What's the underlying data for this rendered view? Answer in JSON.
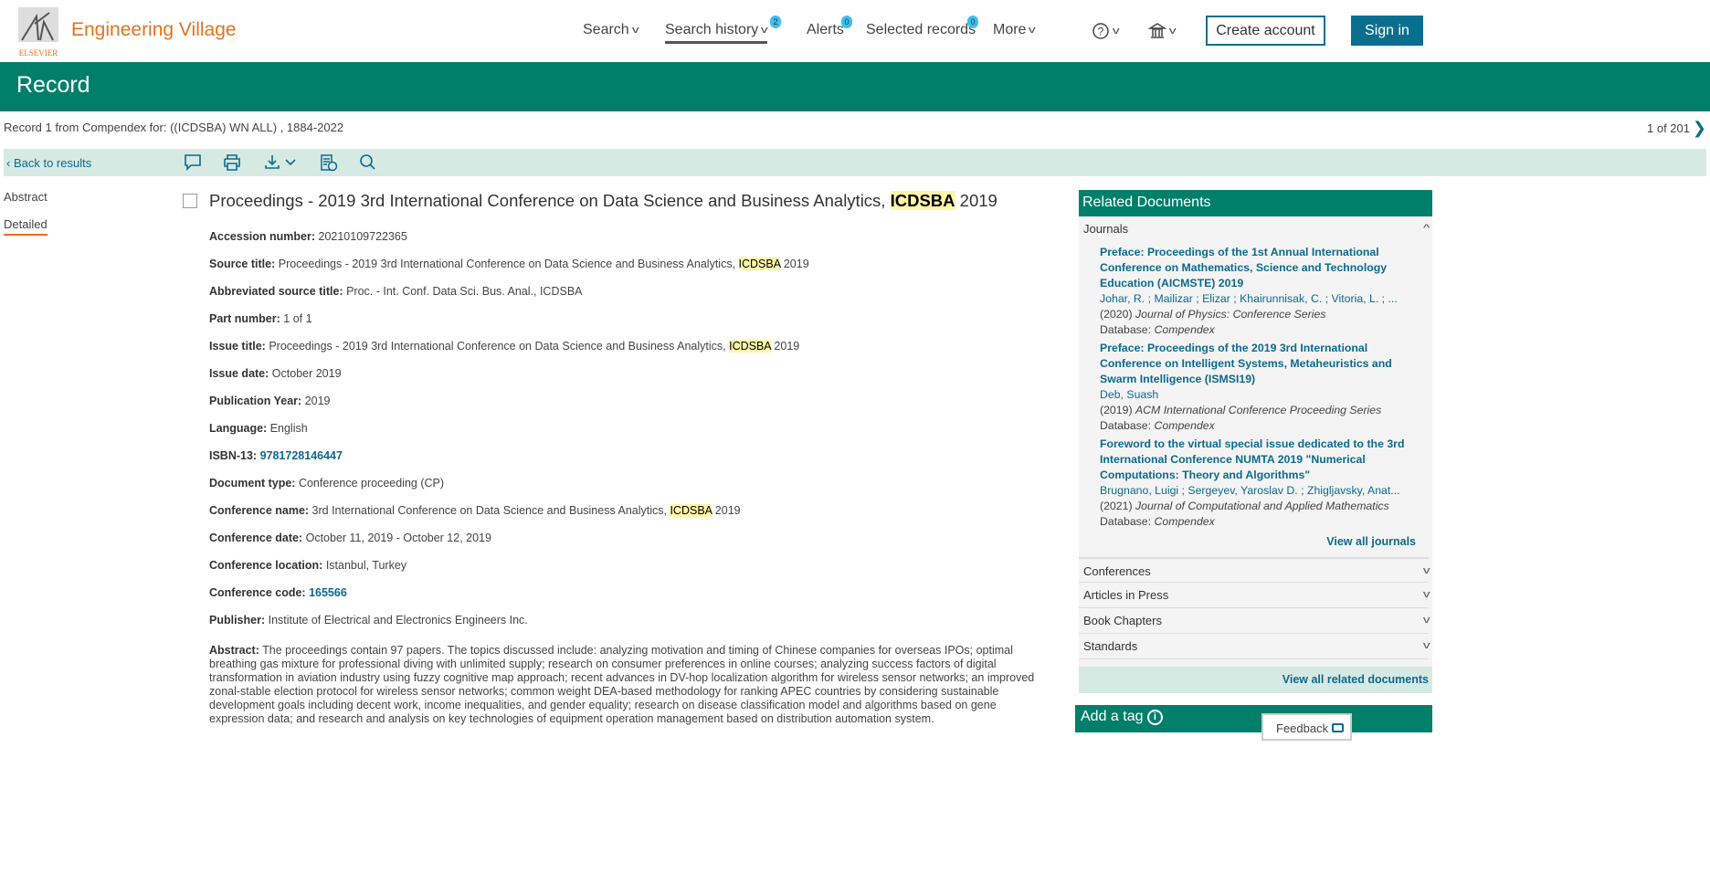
{
  "header": {
    "brand": "Engineering Village",
    "logo_text": "ELSEVIER",
    "nav": [
      {
        "label": "Search"
      },
      {
        "label": "Search history",
        "badge": "2"
      },
      {
        "label": "Alerts",
        "badge": "0"
      },
      {
        "label": "Selected records",
        "badge": "0"
      },
      {
        "label": "More"
      }
    ],
    "create_account": "Create account",
    "sign_in": "Sign in"
  },
  "banner": {
    "title": "Record"
  },
  "crumb": "Record 1 from Compendex for: ((ICDSBA) WN ALL) , 1884-2022",
  "pager": "1 of 201",
  "toolbar": {
    "back": "Back to results"
  },
  "side": {
    "abstract": "Abstract",
    "detailed": "Detailed"
  },
  "record": {
    "title_pre": "Proceedings - 2019 3rd International Conference on Data Science and Business Analytics, ",
    "title_hl": "ICDSBA",
    "title_post": " 2019",
    "fields": [
      {
        "label": "Accession number:",
        "value": "20210109722365"
      },
      {
        "label": "Source title:",
        "value": "Proceedings - 2019 3rd International Conference on Data Science and Business Analytics, ",
        "hl": "ICDSBA",
        "after": " 2019"
      },
      {
        "label": "Abbreviated source title:",
        "value": "Proc. - Int. Conf. Data Sci. Bus. Anal., ICDSBA"
      },
      {
        "label": "Part number:",
        "value": "1 of 1"
      },
      {
        "label": "Issue title:",
        "value": "Proceedings - 2019 3rd International Conference on Data Science and Business Analytics, ",
        "hl": "ICDSBA",
        "after": " 2019"
      },
      {
        "label": "Issue date:",
        "value": "October 2019"
      },
      {
        "label": "Publication Year:",
        "value": "2019"
      },
      {
        "label": "Language:",
        "value": "English"
      },
      {
        "label": "ISBN-13:",
        "link": "9781728146447"
      },
      {
        "label": "Document type:",
        "value": "Conference proceeding (CP)"
      },
      {
        "label": "Conference name:",
        "value": "3rd International Conference on Data Science and Business Analytics, ",
        "hl": "ICDSBA",
        "after": " 2019"
      },
      {
        "label": "Conference date:",
        "value": "October 11, 2019 - October 12, 2019"
      },
      {
        "label": "Conference location:",
        "value": "Istanbul, Turkey"
      },
      {
        "label": "Conference code:",
        "link": "165566"
      },
      {
        "label": "Publisher:",
        "value": "Institute of Electrical and Electronics Engineers Inc."
      }
    ],
    "abstract_label": "Abstract:",
    "abstract": "The proceedings contain 97 papers. The topics discussed include: analyzing motivation and timing of Chinese companies for overseas IPOs; optimal breathing gas mixture for professional diving with unlimited supply; research on consumer preferences in online courses; analyzing success factors of digital transformation in aviation industry using fuzzy cognitive map approach; recent advances in DV-hop localization algorithm for wireless sensor networks; an improved zonal-stable election protocol for wireless sensor networks; common weight DEA-based methodology for ranking APEC countries by considering sustainable development goals including decent work, income inequalities, and gender equality; research on disease classification model and algorithms based on gene expression data; and research and analysis on key technologies of equipment operation management based on distribution automation system."
  },
  "related": {
    "title": "Related Documents",
    "journals_label": "Journals",
    "items": [
      {
        "title": "Preface: Proceedings of the 1st Annual International Conference on Mathematics, Science and Technology Education (AICMSTE) 2019",
        "authors": "Johar, R. ; Mailizar ; Elizar ; Khairunnisak, C. ; Vitoria, L. ; ...",
        "year": "(2020) ",
        "journal": "Journal of Physics: Conference Series",
        "db_label": "Database: ",
        "db": "Compendex"
      },
      {
        "title": "Preface: Proceedings of the 2019 3rd International Conference on Intelligent Systems, Metaheuristics and Swarm Intelligence (ISMSI19)",
        "authors": "Deb, Suash",
        "year": "(2019) ",
        "journal": "ACM International Conference Proceeding Series",
        "db_label": "Database: ",
        "db": "Compendex"
      },
      {
        "title": "Foreword to the virtual special issue dedicated to the 3rd International Conference NUMTA 2019 \"Numerical Computations: Theory and Algorithms\"",
        "authors": "Brugnano, Luigi ; Sergeyev, Yaroslav D. ; Zhigljavsky, Anat...",
        "year": "(2021) ",
        "journal": "Journal of Computational and Applied Mathematics",
        "db_label": "Database: ",
        "db": "Compendex"
      }
    ],
    "view_all_journals": "View all journals",
    "sections": [
      "Conferences",
      "Articles in Press",
      "Book Chapters",
      "Standards"
    ],
    "view_all": "View all related documents"
  },
  "tag": {
    "title": "Add a tag"
  },
  "feedback": "Feedback"
}
